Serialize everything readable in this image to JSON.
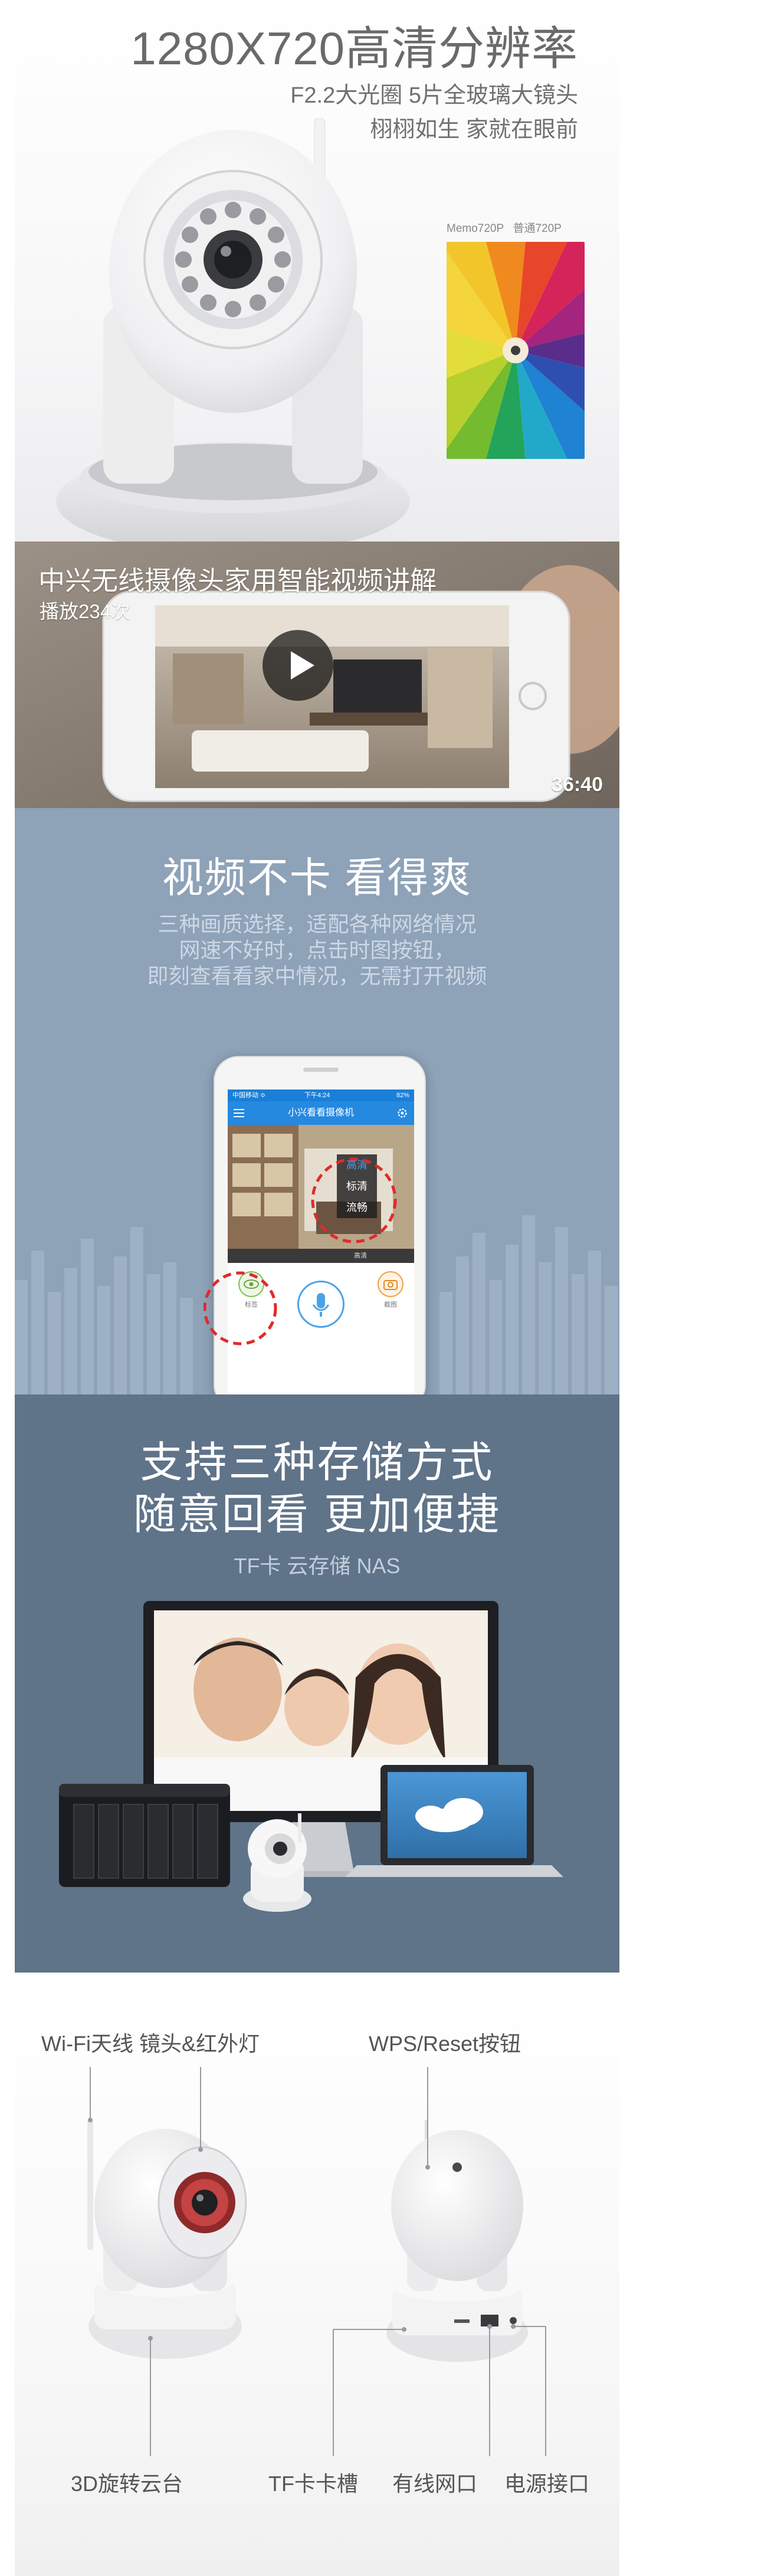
{
  "section1": {
    "title": "1280X720高清分辨率",
    "subtitle1": "F2.2大光圈 5片全玻璃大镜头",
    "subtitle2": "栩栩如生 家就在眼前",
    "compare_label_left": "Memo720P",
    "compare_label_right": "普通720P"
  },
  "section2": {
    "video_title": "中兴无线摄像头家用智能视频讲解",
    "play_count": "播放234次",
    "duration": "36:40"
  },
  "section3": {
    "title": "视频不卡 看得爽",
    "desc_lines": [
      "三种画质选择，适配各种网络情况",
      "网速不好时，点击时图按钮，",
      "即刻查看看家中情况，无需打开视频"
    ],
    "phone": {
      "status_left": "中国移动 ≎",
      "status_mid": "下午4:24",
      "status_right": "82%",
      "app_title": "小兴看看摄像机",
      "quality_options": [
        "高清",
        "标清",
        "流畅"
      ],
      "control_label": "高清",
      "btn_left_label": "标签",
      "btn_right_label": "截图"
    }
  },
  "section4": {
    "title_line1": "支持三种存储方式",
    "title_line2": "随意回看 更加便捷",
    "subtitle": "TF卡 云存储 NAS"
  },
  "section5": {
    "label_antenna": "Wi-Fi天线 镜头&红外灯",
    "label_wps": "WPS/Reset按钮",
    "label_gimbal": "3D旋转云台",
    "label_tf": "TF卡卡槽",
    "label_lan": "有线网口",
    "label_power": "电源接口"
  },
  "colors": {
    "video_bg": "#8a7f75",
    "section3_bg": "#8ea2b8",
    "section4_bg": "#5f7389",
    "app_blue": "#2589e0",
    "highlight_red": "#e02a2a"
  }
}
